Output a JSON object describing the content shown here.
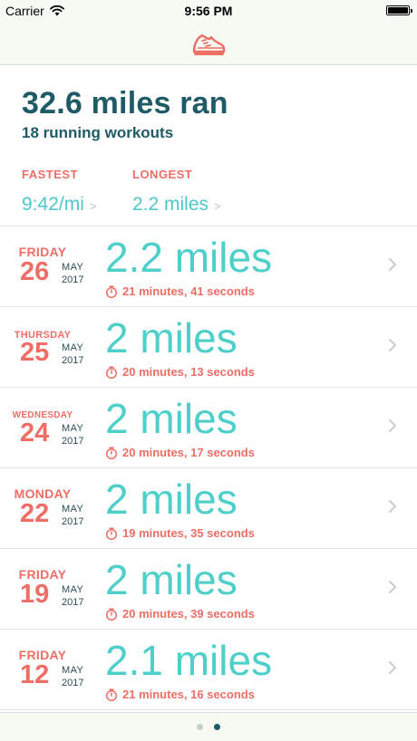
{
  "status_bar": {
    "carrier": "Carrier",
    "time": "9:56 PM"
  },
  "nav": {
    "icon": "running-shoe-icon",
    "accent": "#ee6e66"
  },
  "summary": {
    "total": "32.6 miles ran",
    "workouts": "18 running workouts",
    "fastest_label": "FASTEST",
    "fastest_value": "9:42/mi",
    "longest_label": "LONGEST",
    "longest_value": "2.2 miles"
  },
  "workouts": [
    {
      "day": "FRIDAY",
      "date": "26",
      "month": "MAY",
      "year": "2017",
      "distance": "2.2 miles",
      "duration": "21 minutes, 41 seconds"
    },
    {
      "day": "THURSDAY",
      "date": "25",
      "month": "MAY",
      "year": "2017",
      "distance": "2 miles",
      "duration": "20 minutes, 13 seconds"
    },
    {
      "day": "WEDNESDAY",
      "date": "24",
      "month": "MAY",
      "year": "2017",
      "distance": "2 miles",
      "duration": "20 minutes, 17 seconds"
    },
    {
      "day": "MONDAY",
      "date": "22",
      "month": "MAY",
      "year": "2017",
      "distance": "2 miles",
      "duration": "19 minutes, 35 seconds"
    },
    {
      "day": "FRIDAY",
      "date": "19",
      "month": "MAY",
      "year": "2017",
      "distance": "2 miles",
      "duration": "20 minutes, 39 seconds"
    },
    {
      "day": "FRIDAY",
      "date": "12",
      "month": "MAY",
      "year": "2017",
      "distance": "2.1 miles",
      "duration": "21 minutes, 16 seconds"
    }
  ],
  "page_indicator": {
    "pages": 2,
    "current": 2
  },
  "colors": {
    "accent_coral": "#ee6e66",
    "accent_teal": "#4fcfca",
    "heading_navy": "#1f5b66",
    "bar_background": "#f5fbf3"
  }
}
